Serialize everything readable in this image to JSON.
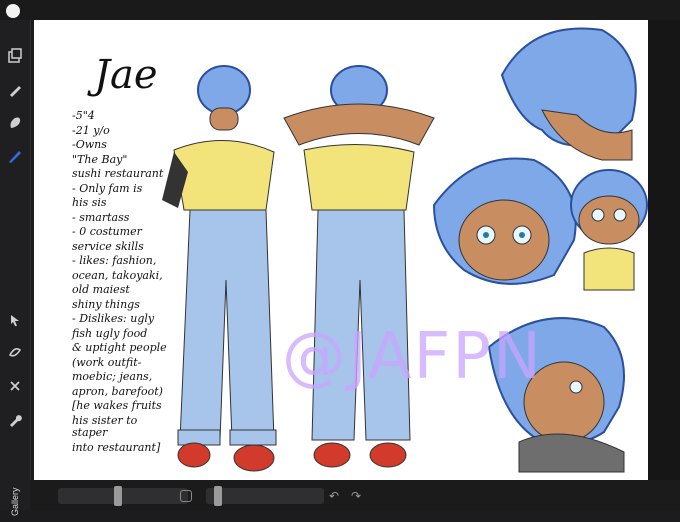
{
  "app": {
    "sidebar": {
      "gallery_label": "Gallery",
      "tools": [
        {
          "icon": "layers-icon"
        },
        {
          "icon": "brush-icon"
        },
        {
          "icon": "smudge-icon"
        },
        {
          "icon": "pen-icon"
        },
        {
          "icon": "select-arrow-icon"
        },
        {
          "icon": "adjust-icon"
        },
        {
          "icon": "transform-icon"
        },
        {
          "icon": "wrench-icon"
        }
      ]
    },
    "bottom": {
      "undo_glyph": "↶",
      "redo_glyph": "↷"
    }
  },
  "canvas": {
    "title": "Jae",
    "notes": [
      "-5\"4",
      "-21 y/o",
      "-Owns",
      " \"The Bay\"",
      " sushi restaurant",
      "- Only fam is",
      "  his sis",
      "- smartass",
      "- 0 costumer",
      "  service skills",
      "- likes: fashion,",
      " ocean, takoyaki,",
      " old maiest",
      " shiny things",
      "- Dislikes: ugly",
      " fish ugly food",
      " & uptight people",
      "(work outfit-",
      " moebic; jeans,",
      " apron, barefoot)",
      "[he wakes fruits",
      " his sister to staper",
      " into restaurant]"
    ],
    "watermark": "@JAFPN"
  },
  "colors": {
    "hair": "#7fa8e8",
    "shirt": "#f2e37a",
    "jeans": "#a7c4ea",
    "shoes": "#d23b2b",
    "skin": "#c98d62",
    "watermark": "#c9a6ff"
  }
}
